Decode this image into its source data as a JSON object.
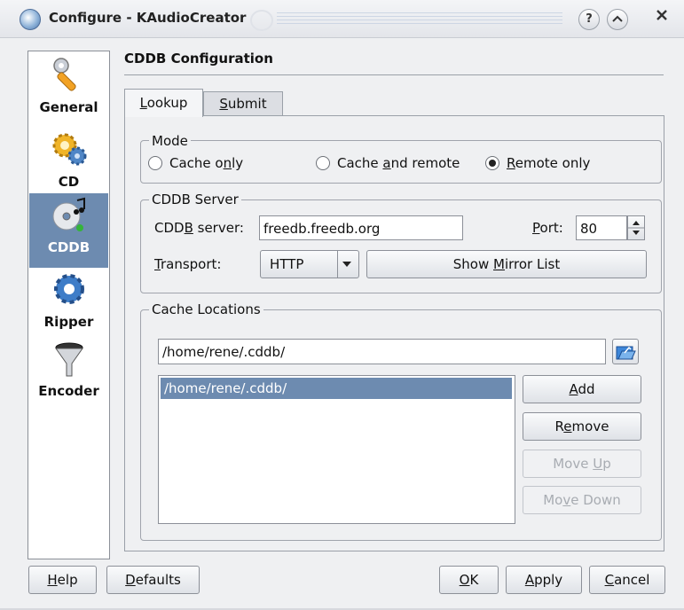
{
  "window": {
    "title": "Configure - KAudioCreator",
    "help_button": "?",
    "shade_button": "^",
    "close_button": "x"
  },
  "sidebar": {
    "items": [
      {
        "label": "General",
        "icon": "wrench-icon"
      },
      {
        "label": "CD",
        "icon": "gears-icon"
      },
      {
        "label": "CDDB",
        "icon": "cd-music-icon"
      },
      {
        "label": "Ripper",
        "icon": "gear-blue-icon"
      },
      {
        "label": "Encoder",
        "icon": "funnel-icon"
      }
    ]
  },
  "page": {
    "title": "CDDB Configuration",
    "tabs": [
      {
        "label": "Lookup",
        "mnemonic_index": 0
      },
      {
        "label": "Submit",
        "mnemonic_index": 0
      }
    ]
  },
  "mode": {
    "title": "Mode",
    "options": [
      {
        "pre": "Cache o",
        "mn": "n",
        "post": "ly",
        "checked": false
      },
      {
        "pre": "Cache ",
        "mn": "a",
        "post": "nd remote",
        "checked": false
      },
      {
        "pre": "",
        "mn": "R",
        "post": "emote only",
        "checked": true
      }
    ]
  },
  "server": {
    "title": "CDDB Server",
    "server_label_pre": "CDD",
    "server_label_mn": "B",
    "server_label_post": " server:",
    "server_value": "freedb.freedb.org",
    "port_label_mn": "P",
    "port_label_post": "ort:",
    "port_value": "80",
    "transport_label_mn": "T",
    "transport_label_post": "ransport:",
    "transport_value": "HTTP",
    "mirror_button_pre": "Show ",
    "mirror_button_mn": "M",
    "mirror_button_post": "irror List"
  },
  "cache": {
    "title": "Cache Locations",
    "path_input": "/home/rene/.cddb/",
    "list_items": [
      "/home/rene/.cddb/"
    ],
    "add_mn": "A",
    "add_post": "dd",
    "remove_pre": "R",
    "remove_mn": "e",
    "remove_post": "move",
    "moveup_pre": "Move ",
    "moveup_mn": "U",
    "moveup_post": "p",
    "movedown_pre": "Mo",
    "movedown_mn": "v",
    "movedown_post": "e Down"
  },
  "footer": {
    "help_mn": "H",
    "help_post": "elp",
    "defaults_mn": "D",
    "defaults_post": "efaults",
    "ok_mn": "O",
    "ok_post": "K",
    "apply_mn": "A",
    "apply_post": "pply",
    "cancel_mn": "C",
    "cancel_post": "ancel"
  },
  "colors": {
    "selection": "#6d8bb0",
    "window_bg": "#eff0f2"
  }
}
